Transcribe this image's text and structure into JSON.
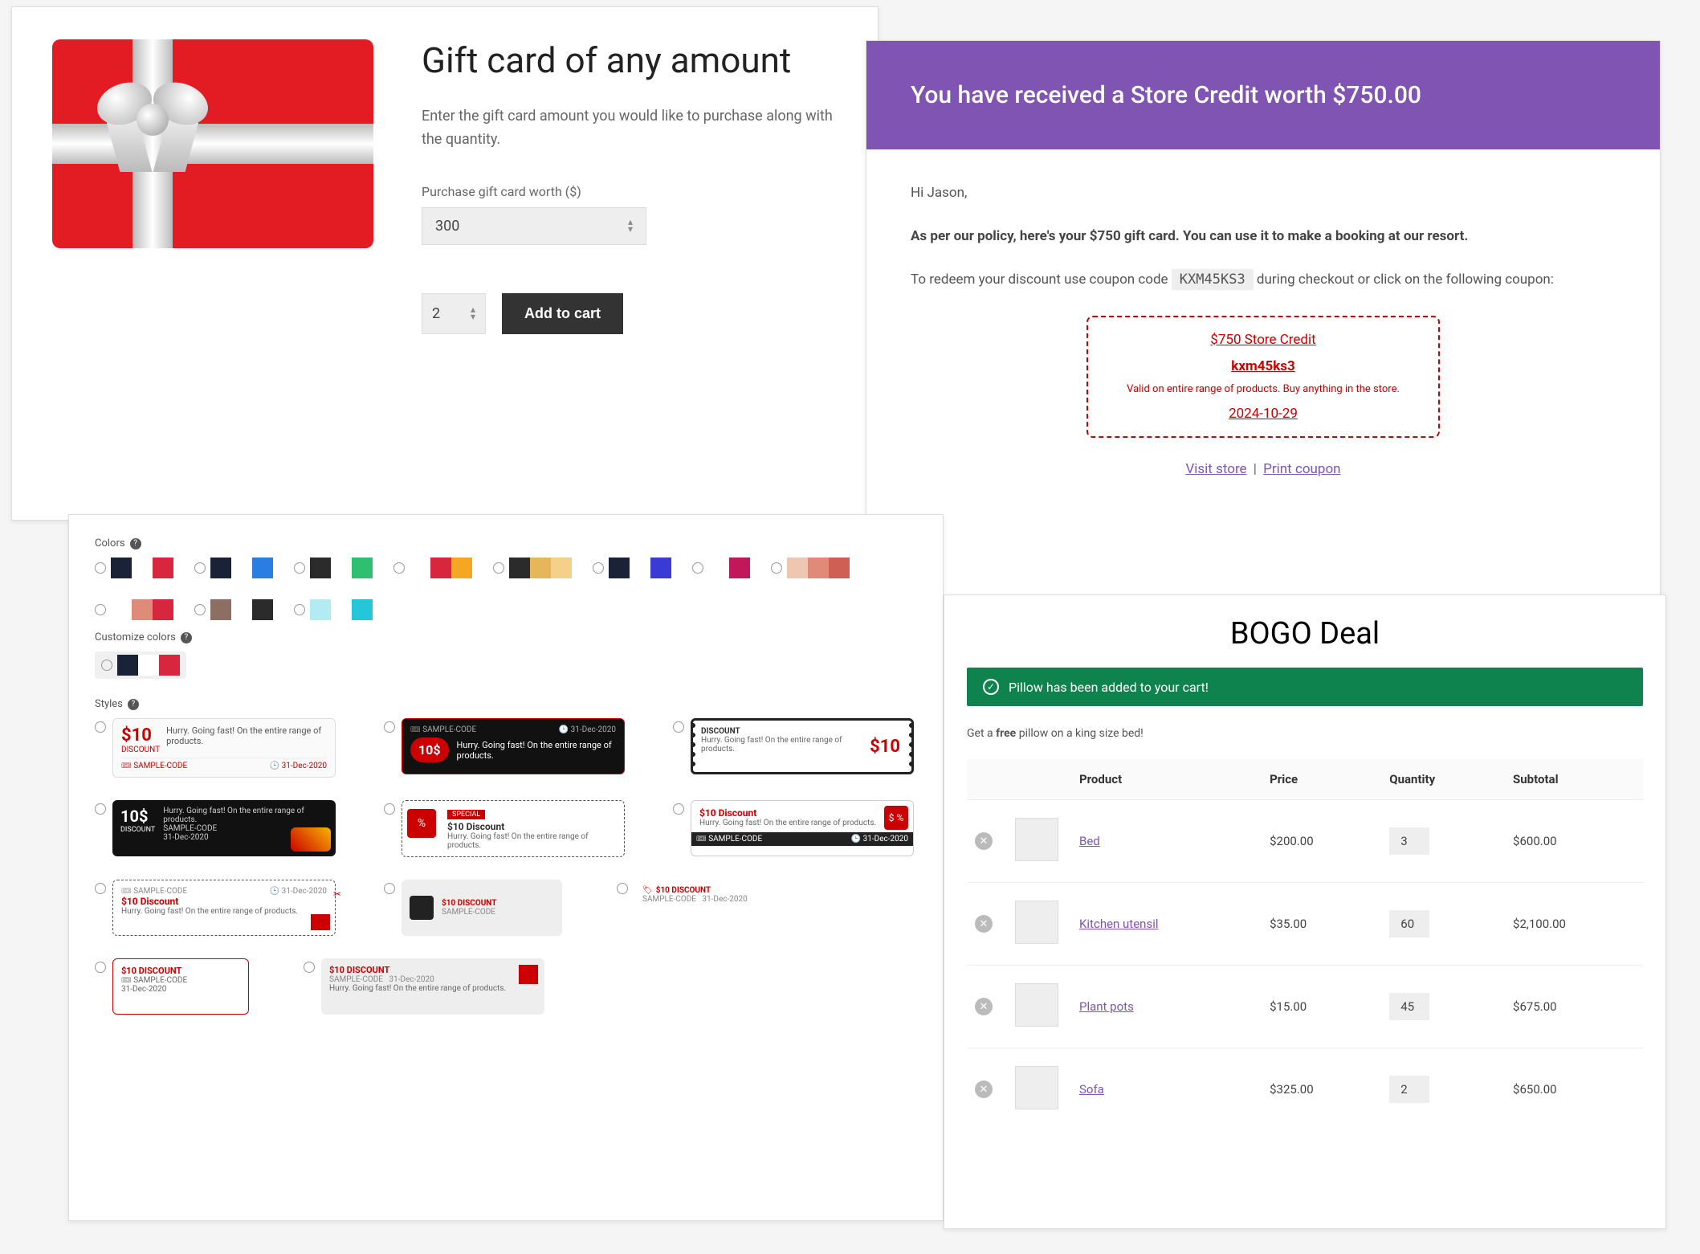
{
  "gift_card": {
    "title": "Gift card of any amount",
    "description": "Enter the gift card amount you would like to purchase along with the quantity.",
    "amount_label": "Purchase gift card worth ($)",
    "amount_value": "300",
    "quantity_value": "2",
    "add_to_cart_label": "Add to cart"
  },
  "store_credit": {
    "header": "You have received a Store Credit worth $750.00",
    "greeting": "Hi Jason,",
    "policy": "As per our policy, here's your $750 gift card. You can use it to make a booking at our resort.",
    "redeem_before": "To redeem your discount use coupon code ",
    "coupon_code_inline": "KXM45KS3",
    "redeem_after": " during checkout or click on the following coupon:",
    "coupon": {
      "title": "$750 Store Credit",
      "code": "kxm45ks3",
      "valid": "Valid on entire range of products. Buy anything in the store.",
      "date": "2024-10-29"
    },
    "links": {
      "visit": "Visit store",
      "print": "Print coupon"
    }
  },
  "coupon_designer": {
    "colors_label": "Colors",
    "customize_label": "Customize colors",
    "styles_label": "Styles",
    "color_palettes": [
      [
        "#1a2238",
        "#ffffff",
        "#d7263d"
      ],
      [
        "#1a2238",
        "#ffffff",
        "#2a7de1"
      ],
      [
        "#2b2b2b",
        "#ffffff",
        "#2fbf71"
      ],
      [
        "#ffffff",
        "#d7263d",
        "#f5a623"
      ],
      [
        "#2b2b2b",
        "#e7b65a",
        "#f5d08a"
      ],
      [
        "#1a2238",
        "#ffffff",
        "#3a3ad6"
      ],
      [
        "#ffffff",
        "#c2185b"
      ],
      [
        "#efc7b0",
        "#e08a7a",
        "#cf5f55"
      ],
      [
        "#ffffff",
        "#e08a7a",
        "#d7263d"
      ],
      [
        "#8d6e63",
        "#ffffff",
        "#2b2b2b"
      ],
      [
        "#b2ebf2",
        "#ffffff",
        "#26c6da"
      ]
    ],
    "customize_palette": [
      "#1a2238",
      "#ffffff",
      "#d7263d"
    ],
    "sample": {
      "amount": "$10",
      "amount_alt": "10$",
      "discount_word": "DISCOUNT",
      "discount_title": "$10 Discount",
      "discount_upper": "$10 DISCOUNT",
      "desc": "Hurry. Going fast! On the entire range of products.",
      "code": "SAMPLE-CODE",
      "date": "31-Dec-2020",
      "special": "SPECIAL"
    }
  },
  "bogo": {
    "title": "BOGO Deal",
    "banner": "Pillow has been added to your cart!",
    "note_before": "Get a ",
    "note_bold": "free",
    "note_after": " pillow on a king size bed!",
    "columns": {
      "product": "Product",
      "price": "Price",
      "quantity": "Quantity",
      "subtotal": "Subtotal"
    },
    "items": [
      {
        "name": "Bed",
        "price": "$200.00",
        "qty": "3",
        "subtotal": "$600.00"
      },
      {
        "name": "Kitchen utensil",
        "price": "$35.00",
        "qty": "60",
        "subtotal": "$2,100.00"
      },
      {
        "name": "Plant pots",
        "price": "$15.00",
        "qty": "45",
        "subtotal": "$675.00"
      },
      {
        "name": "Sofa",
        "price": "$325.00",
        "qty": "2",
        "subtotal": "$650.00"
      }
    ]
  }
}
